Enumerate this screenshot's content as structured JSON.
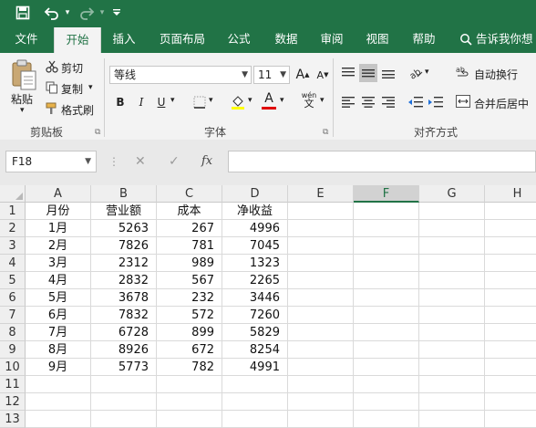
{
  "qat": {
    "save_icon": "save-icon",
    "undo_icon": "undo-icon",
    "redo_icon": "redo-icon",
    "more_icon": "customize-icon"
  },
  "tabs": [
    {
      "label": "文件"
    },
    {
      "label": "开始"
    },
    {
      "label": "插入"
    },
    {
      "label": "页面布局"
    },
    {
      "label": "公式"
    },
    {
      "label": "数据"
    },
    {
      "label": "审阅"
    },
    {
      "label": "视图"
    },
    {
      "label": "帮助"
    }
  ],
  "active_tab": "开始",
  "tell_me": "告诉我你想",
  "ribbon": {
    "clipboard": {
      "paste": "粘贴",
      "cut": "剪切",
      "copy": "复制",
      "format_painter": "格式刷",
      "group": "剪贴板"
    },
    "font": {
      "name": "等线",
      "size": "11",
      "grow": "A",
      "shrink": "A",
      "bold": "B",
      "italic": "I",
      "underline": "U",
      "font_color_letter": "A",
      "phonetic": "wén",
      "group": "字体"
    },
    "alignment": {
      "wrap": "自动换行",
      "merge": "合并后居中",
      "group": "对齐方式"
    }
  },
  "name_box": "F18",
  "fx": "fx",
  "sheet": {
    "columns": [
      "A",
      "B",
      "C",
      "D",
      "E",
      "F",
      "G",
      "H"
    ],
    "selected_column": "F",
    "rows": [
      [
        "月份",
        "营业额",
        "成本",
        "净收益"
      ],
      [
        "1月",
        "5263",
        "267",
        "4996"
      ],
      [
        "2月",
        "7826",
        "781",
        "7045"
      ],
      [
        "3月",
        "2312",
        "989",
        "1323"
      ],
      [
        "4月",
        "2832",
        "567",
        "2265"
      ],
      [
        "5月",
        "3678",
        "232",
        "3446"
      ],
      [
        "6月",
        "7832",
        "572",
        "7260"
      ],
      [
        "7月",
        "6728",
        "899",
        "5829"
      ],
      [
        "8月",
        "8926",
        "672",
        "8254"
      ],
      [
        "9月",
        "5773",
        "782",
        "4991"
      ],
      [
        "",
        "",
        "",
        ""
      ],
      [
        "",
        "",
        "",
        ""
      ],
      [
        "",
        "",
        "",
        ""
      ]
    ],
    "row_numbers": [
      "1",
      "2",
      "3",
      "4",
      "5",
      "6",
      "7",
      "8",
      "9",
      "10",
      "11",
      "12",
      "13"
    ]
  },
  "colors": {
    "brand": "#217346",
    "ribbon_bg": "#f3f3f3",
    "font_color": "#e00000",
    "highlight": "#ffff00"
  }
}
